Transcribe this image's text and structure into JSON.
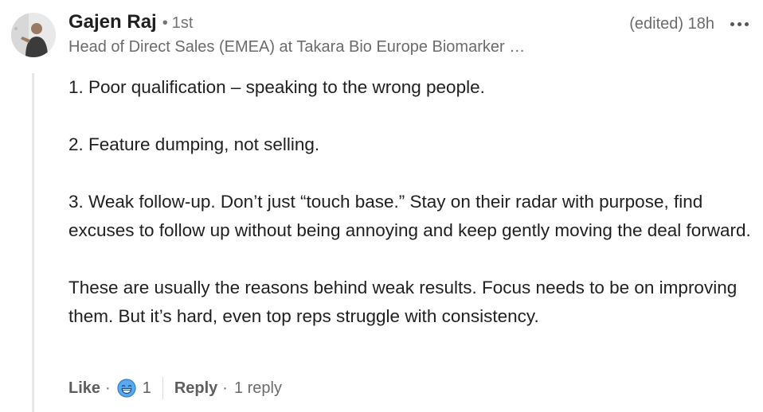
{
  "author": {
    "name": "Gajen Raj",
    "separator": "•",
    "degree": "1st",
    "headline": "Head of Direct Sales (EMEA) at Takara Bio Europe Biomarker …"
  },
  "meta": {
    "timestamp": "(edited) 18h",
    "more_icon": "ellipsis-icon"
  },
  "comment": {
    "paragraphs": [
      "1. Poor qualification – speaking to the wrong people.",
      "2. Feature dumping, not selling.",
      "3. Weak follow-up. Don’t just “touch base.” Stay on their radar with purpose, find excuses to follow up without being annoying and keep gently moving the deal forward.",
      "These are usually the reasons behind weak results. Focus needs to be on improving them. But it’s hard, even top reps struggle with consistency."
    ]
  },
  "actions": {
    "like_label": "Like",
    "separator": "·",
    "reaction_icon": "laugh-reaction-icon",
    "reaction_count": "1",
    "reply_label": "Reply",
    "reply_count": "1 reply"
  },
  "colors": {
    "text": "#1f1f1f",
    "secondary": "#6b6b6b",
    "reaction_blue": "#378fe9",
    "thread_line": "#e8e8e8"
  }
}
